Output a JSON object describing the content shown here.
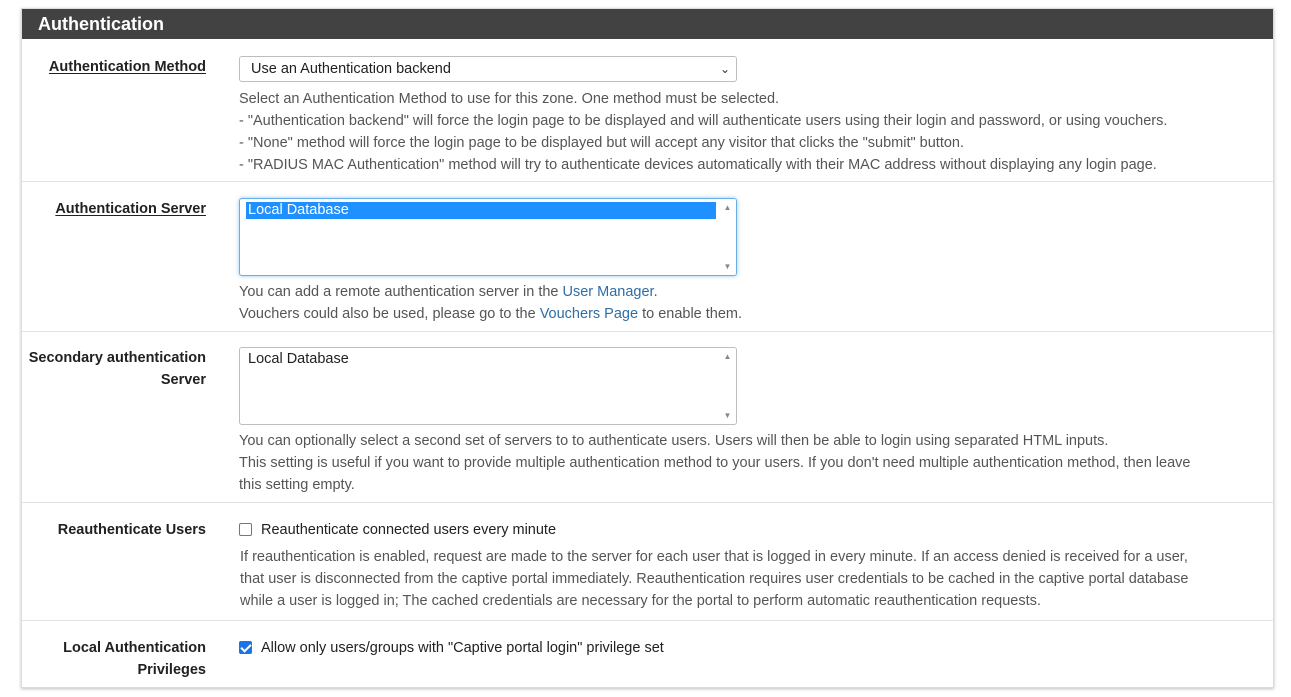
{
  "panel": {
    "title": "Authentication"
  },
  "auth_method": {
    "label": "Authentication Method",
    "selected": "Use an Authentication backend",
    "help": [
      "Select an Authentication Method to use for this zone. One method must be selected.",
      "- \"Authentication backend\" will force the login page to be displayed and will authenticate users using their login and password, or using vouchers.",
      "- \"None\" method will force the login page to be displayed but will accept any visitor that clicks the \"submit\" button.",
      "- \"RADIUS MAC Authentication\" method will try to authenticate devices automatically with their MAC address without displaying any login page."
    ]
  },
  "auth_server": {
    "label": "Authentication Server",
    "options": [
      "Local Database"
    ],
    "help1_prefix": "You can add a remote authentication server in the ",
    "help1_link": "User Manager",
    "help1_suffix": ".",
    "help2_prefix": "Vouchers could also be used, please go to the ",
    "help2_link": "Vouchers Page",
    "help2_suffix": " to enable them."
  },
  "secondary_server": {
    "label_line1": "Secondary authentication",
    "label_line2": "Server",
    "options": [
      "Local Database"
    ],
    "help": [
      "You can optionally select a second set of servers to to authenticate users. Users will then be able to login using separated HTML inputs.",
      "This setting is useful if you want to provide multiple authentication method to your users. If you don't need multiple authentication method, then leave",
      "this setting empty."
    ]
  },
  "reauth": {
    "label": "Reauthenticate Users",
    "checkbox_label": "Reauthenticate connected users every minute",
    "checked": false,
    "help": [
      "If reauthentication is enabled, request are made to the server for each user that is logged in every minute. If an access denied is received for a user,",
      "that user is disconnected from the captive portal immediately. Reauthentication requires user credentials to be cached in the captive portal database",
      "while a user is logged in; The cached credentials are necessary for the portal to perform automatic reauthentication requests."
    ]
  },
  "local_priv": {
    "label_line1": "Local Authentication",
    "label_line2": "Privileges",
    "checkbox_label": "Allow only users/groups with \"Captive portal login\" privilege set",
    "checked": true
  }
}
